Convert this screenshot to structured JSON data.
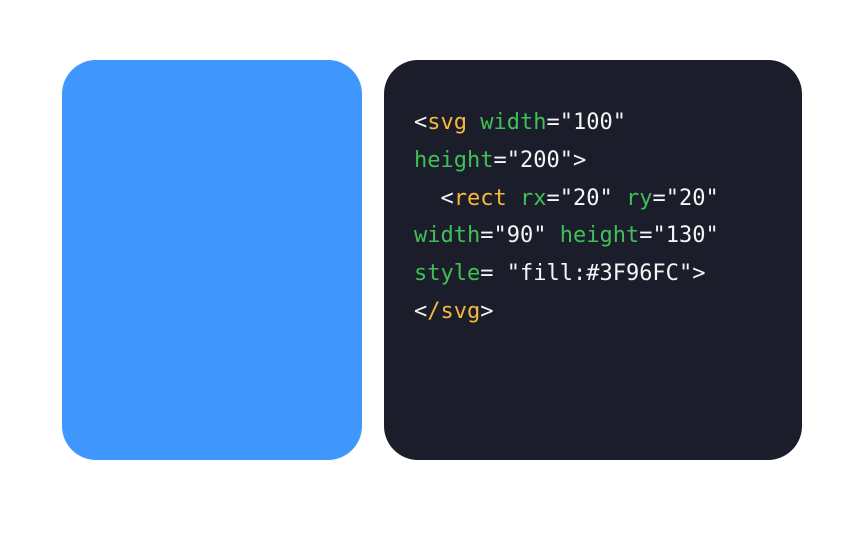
{
  "preview": {
    "fill": "#3F96FC",
    "border_radius_px": 34
  },
  "code": {
    "svgTag": "svg",
    "rectTag": "rect",
    "svgClose": "/svg",
    "attrs": {
      "svgWidth": {
        "name": "width",
        "value": "100"
      },
      "svgHeight": {
        "name": "height",
        "value": "200"
      },
      "rectRx": {
        "name": "rx",
        "value": "20"
      },
      "rectRy": {
        "name": "ry",
        "value": "20"
      },
      "rectWidth": {
        "name": "width",
        "value": "90"
      },
      "rectHeight": {
        "name": "height",
        "value": "130"
      },
      "rectStyle": {
        "name": "style",
        "value": "fill:#3F96FC"
      }
    },
    "indent": "  "
  }
}
